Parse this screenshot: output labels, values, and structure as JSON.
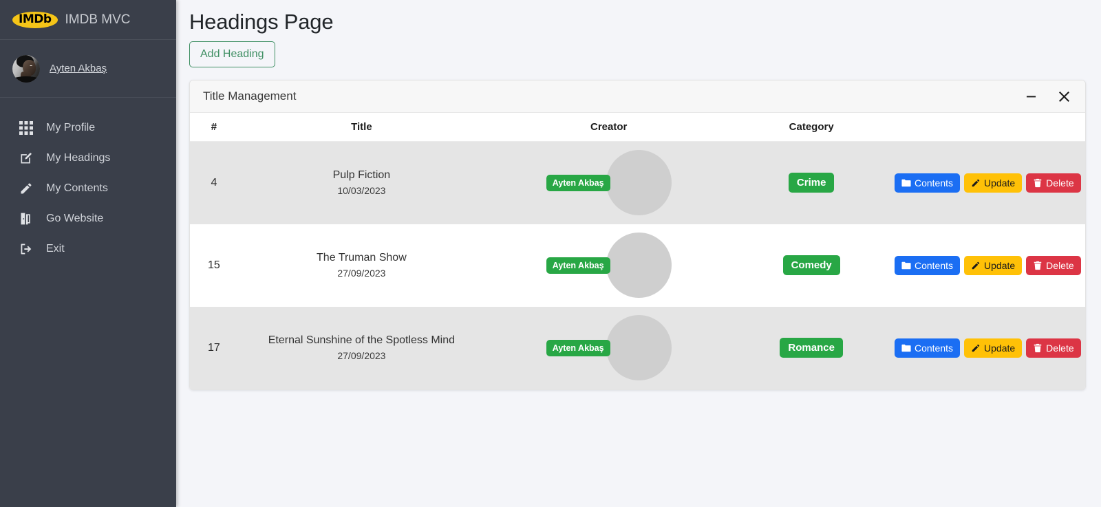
{
  "sidebar": {
    "brand": {
      "logo_text": "IMDb",
      "title": "IMDB MVC",
      "logo_color": "#f5c518"
    },
    "profile": {
      "name": "Ayten Akbaş",
      "avatar": "user-avatar"
    },
    "items": [
      {
        "label": "My Profile",
        "icon": "grid-icon"
      },
      {
        "label": "My Headings",
        "icon": "pen-to-square-icon"
      },
      {
        "label": "My Contents",
        "icon": "pencil-icon"
      },
      {
        "label": "Go Website",
        "icon": "door-open-icon"
      },
      {
        "label": "Exit",
        "icon": "sign-out-icon"
      }
    ]
  },
  "main": {
    "page_title": "Headings Page",
    "add_button": "Add Heading"
  },
  "card": {
    "title": "Title Management",
    "minimize_icon": "minimize-icon",
    "close_icon": "close-icon",
    "columns": [
      "#",
      "Title",
      "Creator",
      "Category"
    ],
    "rows": [
      {
        "id": "4",
        "title": "Pulp Fiction",
        "date": "10/03/2023",
        "creator": "Ayten Akbaş",
        "category": "Crime",
        "category_color": "#28a745",
        "actions": [
          {
            "label": "Contents",
            "icon": "folder-icon",
            "color": "#1b6ef3"
          },
          {
            "label": "Update",
            "icon": "pencil-icon",
            "color": "#ffc107"
          },
          {
            "label": "Delete",
            "icon": "trash-icon",
            "color": "#dc3545"
          }
        ]
      },
      {
        "id": "15",
        "title": "The Truman Show",
        "date": "27/09/2023",
        "creator": "Ayten Akbaş",
        "category": "Comedy",
        "category_color": "#28a745",
        "actions": [
          {
            "label": "Contents",
            "icon": "folder-icon",
            "color": "#1b6ef3"
          },
          {
            "label": "Update",
            "icon": "pencil-icon",
            "color": "#ffc107"
          },
          {
            "label": "Delete",
            "icon": "trash-icon",
            "color": "#dc3545"
          }
        ]
      },
      {
        "id": "17",
        "title": "Eternal Sunshine of the Spotless Mind",
        "date": "27/09/2023",
        "creator": "Ayten Akbaş",
        "category": "Romance",
        "category_color": "#28a745",
        "actions": [
          {
            "label": "Contents",
            "icon": "folder-icon",
            "color": "#1b6ef3"
          },
          {
            "label": "Update",
            "icon": "pencil-icon",
            "color": "#ffc107"
          },
          {
            "label": "Delete",
            "icon": "trash-icon",
            "color": "#dc3545"
          }
        ]
      }
    ]
  },
  "theme": {
    "sidebar_bg": "#3a3f4a",
    "page_bg": "#f4f5f9",
    "accent_green": "#3f8f63",
    "badge_green": "#28a745"
  }
}
